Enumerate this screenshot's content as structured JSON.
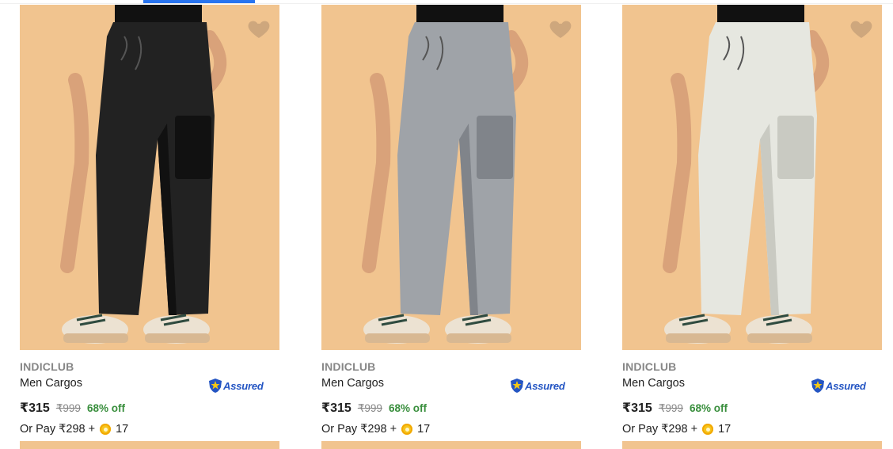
{
  "products": [
    {
      "brand": "INDICLUB",
      "title": "Men Cargos",
      "assured_label": "Assured",
      "price": "₹315",
      "mrp": "₹999",
      "discount": "68% off",
      "pay_prefix": "Or Pay ₹298 +",
      "coins": "17",
      "pant_color": "#222222",
      "pant_shadow": "#111111"
    },
    {
      "brand": "INDICLUB",
      "title": "Men Cargos",
      "assured_label": "Assured",
      "price": "₹315",
      "mrp": "₹999",
      "discount": "68% off",
      "pay_prefix": "Or Pay ₹298 +",
      "coins": "17",
      "pant_color": "#9fa3a8",
      "pant_shadow": "#80848a"
    },
    {
      "brand": "INDICLUB",
      "title": "Men Cargos",
      "assured_label": "Assured",
      "price": "₹315",
      "mrp": "₹999",
      "discount": "68% off",
      "pay_prefix": "Or Pay ₹298 +",
      "coins": "17",
      "pant_color": "#e6e7e0",
      "pant_shadow": "#c9cac2"
    }
  ],
  "colors": {
    "background_photo": "#f1c48f",
    "accent": "#2874f0",
    "discount_green": "#388e3c",
    "assured_blue": "#2455c3"
  },
  "icons": {
    "wishlist": "heart-icon",
    "assured": "assured-badge-icon",
    "coin": "supercoin-icon"
  }
}
